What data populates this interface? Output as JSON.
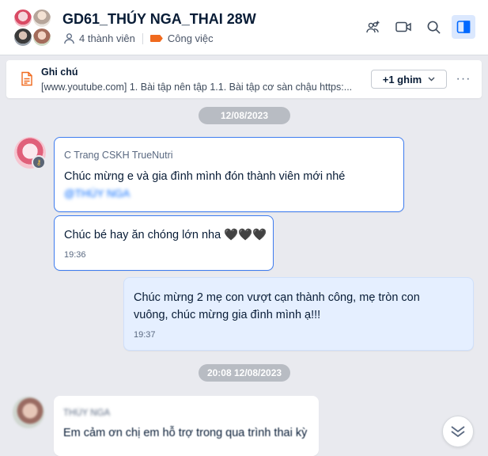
{
  "header": {
    "title": "GD61_THÚY NGA_THAI 28W",
    "members": "4 thành viên",
    "tag": "Công việc",
    "tag_color": "#f06a1e",
    "icons": [
      "add-member-icon",
      "video-call-icon",
      "search-icon",
      "toggle-sidebar-icon"
    ]
  },
  "pinned": {
    "title": "Ghi chú",
    "text": "[www.youtube.com] 1. Bài tập nên tập 1.1. Bài tập cơ sàn chậu https:...",
    "pin_label": "+1 ghim",
    "more_label": "···"
  },
  "messages": {
    "date1": "12/08/2023",
    "m1_sender": "C Trang CSKH TrueNutri",
    "m1_text": "Chúc mừng e và gia đình mình đón thành viên mới nhé",
    "m1_mention": "@THÚY NGA",
    "m2_text": "Chúc bé hay ăn chóng lớn nha 🖤🖤🖤",
    "m2_time": "19:36",
    "m3_line1": "Chúc mừng 2 mẹ con vượt cạn thành công, mẹ tròn con",
    "m3_line2": "vuông, chúc mừng gia đình mình ạ!!!",
    "m3_time": "19:37",
    "date2": "20:08 12/08/2023",
    "m4_sender": "THÚY NGA",
    "m4_text": "Em cảm ơn chị em hỗ trợ trong qua trình thai kỳ"
  },
  "colors": {
    "accent": "#0068ff",
    "background": "#e9eaef",
    "my_bubble": "#e5efff"
  }
}
